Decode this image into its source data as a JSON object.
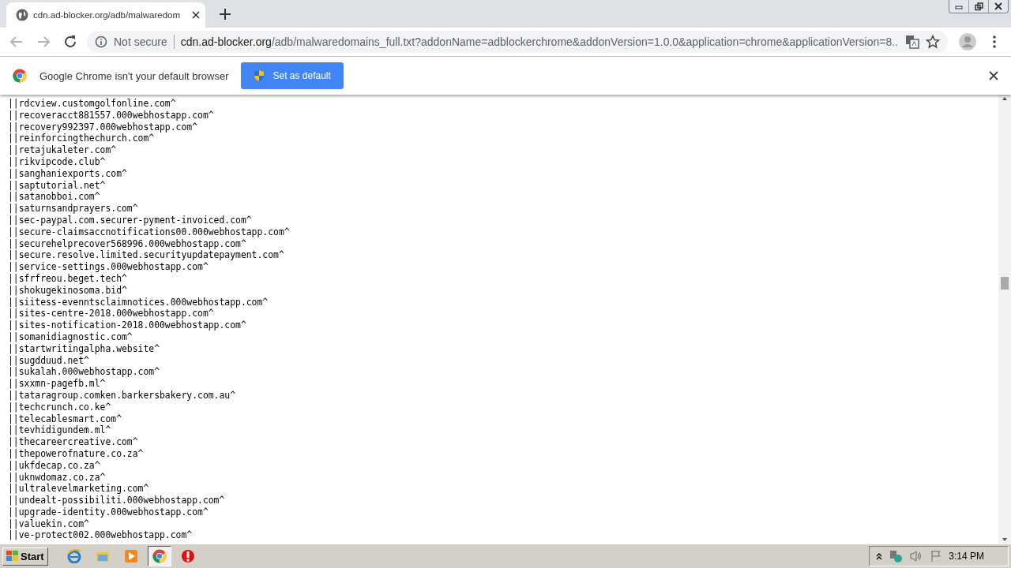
{
  "tabs": [
    {
      "title": "cdn.ad-blocker.org/adb/malwaredom",
      "selected": true
    }
  ],
  "address": {
    "security": "Not secure",
    "host": "cdn.ad-blocker.org",
    "path": "/adb/malwaredomains_full.txt?addonName=adblockerchrome&addonVersion=1.0.0&application=chrome&applicationVersion=8..."
  },
  "infobar": {
    "message": "Google Chrome isn't your default browser",
    "button": "Set as default"
  },
  "lines": [
    "||rdcview.customgolfonline.com^",
    "||recoveracct881557.000webhostapp.com^",
    "||recovery992397.000webhostapp.com^",
    "||reinforcingthechurch.com^",
    "||retajukaleter.com^",
    "||rikvipcode.club^",
    "||sanghaniexports.com^",
    "||saptutorial.net^",
    "||satanobboi.com^",
    "||saturnsandprayers.com^",
    "||sec-paypal.com.securer-pyment-invoiced.com^",
    "||secure-claimsaccnotifications00.000webhostapp.com^",
    "||securehelprecover568996.000webhostapp.com^",
    "||secure.resolve.limited.securityupdatepayment.com^",
    "||service-settings.000webhostapp.com^",
    "||sfrfreou.beget.tech^",
    "||shokugekinosoma.bid^",
    "||siitess-evenntsclaimnotices.000webhostapp.com^",
    "||sites-centre-2018.000webhostapp.com^",
    "||sites-notification-2018.000webhostapp.com^",
    "||somanidiagnostic.com^",
    "||startwritingalpha.website^",
    "||sugdduud.net^",
    "||sukalah.000webhostapp.com^",
    "||sxxmn-pagefb.ml^",
    "||tataragroup.comken.barkersbakery.com.au^",
    "||techcrunch.co.ke^",
    "||telecablesmart.com^",
    "||tevhidigundem.ml^",
    "||thecareercreative.com^",
    "||thepowerofnature.co.za^",
    "||ukfdecap.co.za^",
    "||uknwdomaz.co.za^",
    "||ultralevelmarketing.com^",
    "||undealt-possibiliti.000webhostapp.com^",
    "||upgrade-identity.000webhostapp.com^",
    "||valuekin.com^",
    "||ve-protect002.000webhostapp.com^"
  ],
  "taskbar": {
    "start": "Start",
    "apps": [
      {
        "kind": "ie",
        "selected": false
      },
      {
        "kind": "folder",
        "selected": false
      },
      {
        "kind": "media",
        "selected": false
      },
      {
        "kind": "chrome",
        "selected": true
      },
      {
        "kind": "stop",
        "selected": false
      }
    ],
    "clock": "3:14 PM"
  }
}
